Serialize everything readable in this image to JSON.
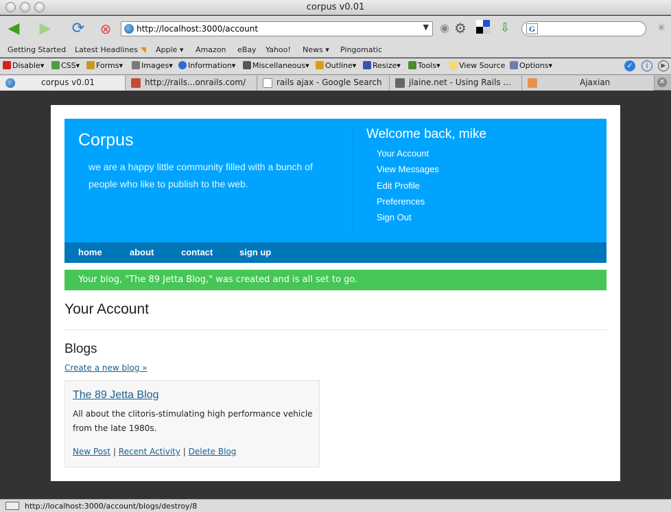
{
  "window": {
    "title": "corpus v0.01"
  },
  "nav": {
    "url": "http://localhost:3000/account",
    "search_engine_letter": "G"
  },
  "bookmarks": [
    {
      "label": "Getting Started"
    },
    {
      "label": "Latest Headlines"
    },
    {
      "label": "Apple"
    },
    {
      "label": "Amazon"
    },
    {
      "label": "eBay"
    },
    {
      "label": "Yahoo!"
    },
    {
      "label": "News"
    },
    {
      "label": "Pingomatic"
    }
  ],
  "devtools": [
    {
      "label": "Disable"
    },
    {
      "label": "CSS"
    },
    {
      "label": "Forms"
    },
    {
      "label": "Images"
    },
    {
      "label": "Information"
    },
    {
      "label": "Miscellaneous"
    },
    {
      "label": "Outline"
    },
    {
      "label": "Resize"
    },
    {
      "label": "Tools"
    },
    {
      "label": "View Source"
    },
    {
      "label": "Options"
    }
  ],
  "tabs": [
    {
      "label": "corpus v0.01"
    },
    {
      "label": "http://rails...onrails.com/"
    },
    {
      "label": "rails ajax - Google Search"
    },
    {
      "label": "jlaine.net - Using Rails ..."
    },
    {
      "label": "Ajaxian"
    }
  ],
  "site": {
    "brand": "Corpus",
    "tagline": "we are a happy little community filled with a bunch of people who like to publish to the web.",
    "welcome": "Welcome back, mike",
    "account_menu": [
      "Your Account",
      "View Messages",
      "Edit Profile",
      "Preferences",
      "Sign Out"
    ],
    "main_nav": [
      "home",
      "about",
      "contact",
      "sign up"
    ],
    "flash": "Your blog, \"The 89 Jetta Blog,\" was created and is all set to go.",
    "page_title": "Your Account",
    "blogs_heading": "Blogs",
    "new_blog_link": "Create a new blog »",
    "blog": {
      "title": "The 89 Jetta Blog",
      "description": "All about the clitoris-stimulating high performance vehicle from the late 1980s.",
      "actions": [
        "New Post",
        "Recent Activity",
        "Delete Blog"
      ]
    }
  },
  "status": {
    "text": "http://localhost:3000/account/blogs/destroy/8"
  },
  "colors": {
    "header": "#00a4ff",
    "nav": "#0176b9",
    "flash": "#45c656",
    "link": "#1a5f8f"
  }
}
